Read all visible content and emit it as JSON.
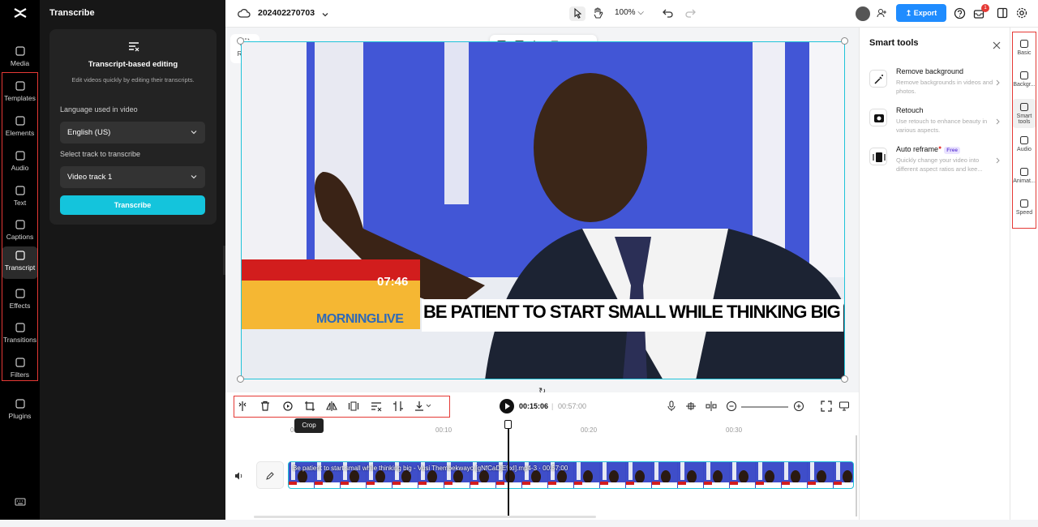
{
  "rail": {
    "items": [
      {
        "label": "Media",
        "icon": "cloud-upload-icon"
      },
      {
        "label": "Templates",
        "icon": "template-icon"
      },
      {
        "label": "Elements",
        "icon": "elements-icon"
      },
      {
        "label": "Audio",
        "icon": "music-note-icon"
      },
      {
        "label": "Text",
        "icon": "text-icon"
      },
      {
        "label": "Captions",
        "icon": "captions-icon"
      },
      {
        "label": "Transcript",
        "icon": "transcript-icon",
        "active": true
      },
      {
        "label": "Effects",
        "icon": "sparkle-icon"
      },
      {
        "label": "Transitions",
        "icon": "transitions-icon"
      },
      {
        "label": "Filters",
        "icon": "filters-icon"
      },
      {
        "label": "Plugins",
        "icon": "plugins-icon"
      }
    ]
  },
  "transcribe": {
    "panel_title": "Transcribe",
    "card_title": "Transcript-based editing",
    "card_subtitle": "Edit videos quickly by editing their transcripts.",
    "language_label": "Language used in video",
    "language_value": "English (US)",
    "track_label": "Select track to transcribe",
    "track_value": "Video track 1",
    "button": "Transcribe"
  },
  "topbar": {
    "project_name": "202402270703",
    "zoom": "100%",
    "export": "Export",
    "notification_count": "1"
  },
  "canvas": {
    "ratio_label": "Ratio",
    "video_time_overlay": "07:46",
    "video_brand": "MORNINGLIVE",
    "video_headline": "BE PATIENT TO START SMALL WHILE THINKING BIG"
  },
  "smart_tools": {
    "title": "Smart tools",
    "tools": [
      {
        "name": "Remove background",
        "desc": "Remove backgrounds in videos and photos."
      },
      {
        "name": "Retouch",
        "desc": "Use retouch to enhance beauty in various aspects."
      },
      {
        "name": "Auto reframe",
        "badge": "Free",
        "desc": "Quickly change your video into different aspect ratios and kee..."
      }
    ]
  },
  "right_rail": {
    "items": [
      {
        "label": "Basic",
        "icon": "basic-icon"
      },
      {
        "label": "Backgr...",
        "icon": "background-icon"
      },
      {
        "label": "Smart tools",
        "icon": "magic-wand-icon",
        "active": true
      },
      {
        "label": "Audio",
        "icon": "music-note-icon"
      },
      {
        "label": "Animat...",
        "icon": "animation-icon"
      },
      {
        "label": "Speed",
        "icon": "speed-icon"
      }
    ]
  },
  "playback": {
    "current_time": "00:15:06",
    "total_time": "00:57:00",
    "tooltip": "Crop"
  },
  "timeline": {
    "ticks": [
      "00:00",
      "00:10",
      "00:20",
      "00:30"
    ],
    "clip_label": "Be patient to start small while thinking big - Vusi Thembekwayo [gNfCaDjE9xI].mp4-3 · 00:57:00"
  },
  "colors": {
    "accent": "#20c3d9",
    "transcribe_button": "#14c4dc",
    "export_button": "#1f8cff",
    "highlight_box": "#e53935"
  }
}
